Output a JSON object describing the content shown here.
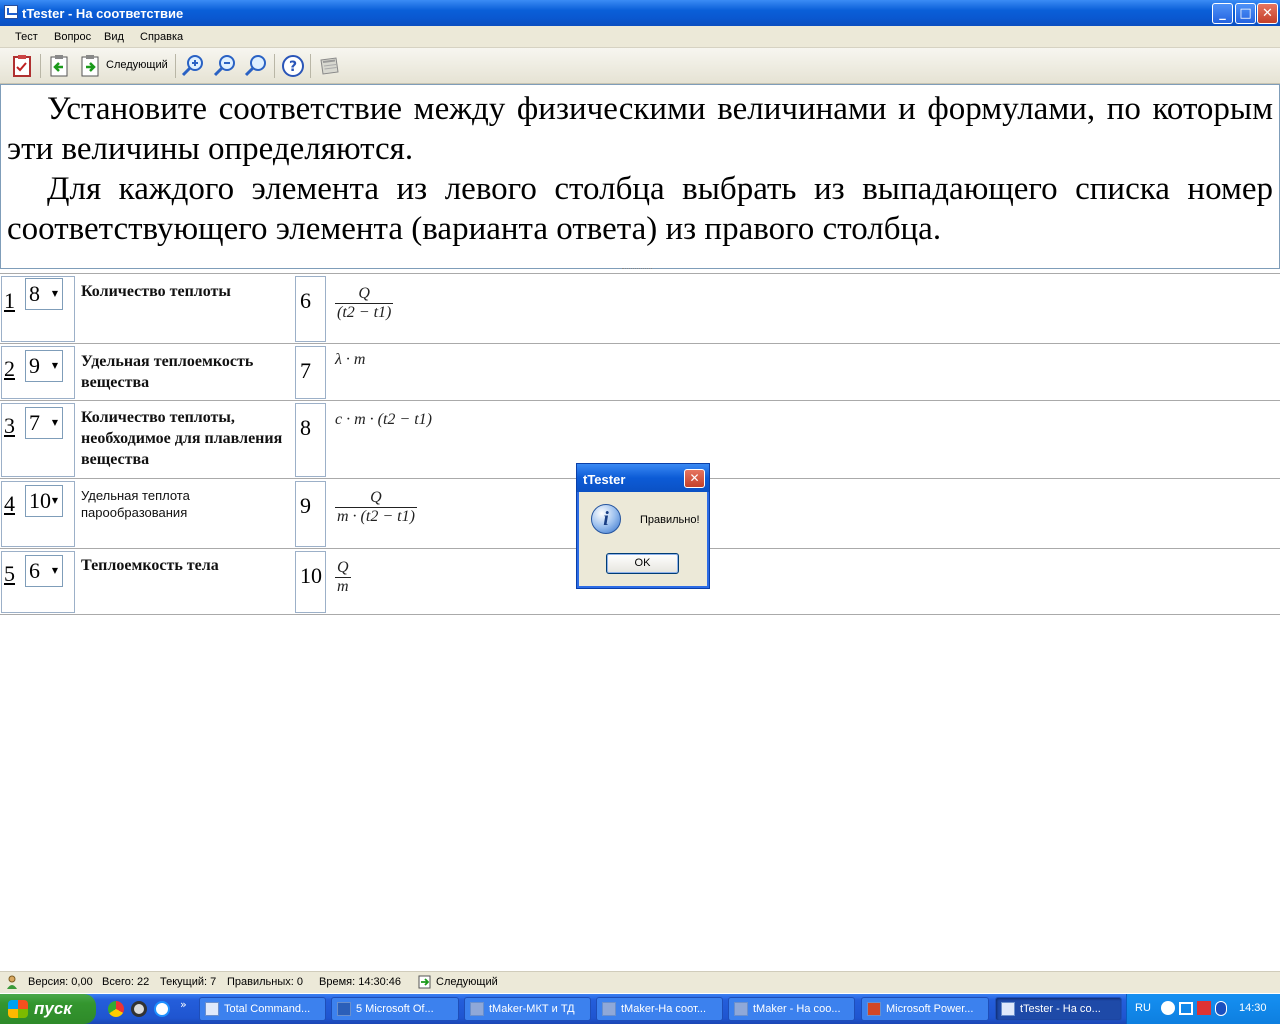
{
  "window": {
    "title": "tTester - На соответствие"
  },
  "menu": [
    "Тест",
    "Вопрос",
    "Вид",
    "Справка"
  ],
  "toolbar": {
    "next_label": "Следующий"
  },
  "question": {
    "para1": "Установите соответствие между физическими величинами и формулами, по которым эти величины определяются.",
    "para2": "Для каждого элемента из левого столбца выбрать из выпадающего списка номер соответствующего элемента (варианта ответа) из правого столбца."
  },
  "rows": [
    {
      "num": "1",
      "selected": "8",
      "label": "Количество теплоты",
      "rnum": "6"
    },
    {
      "num": "2",
      "selected": "9",
      "label": "Удельная теплоемкость вещества",
      "rnum": "7"
    },
    {
      "num": "3",
      "selected": "7",
      "label": "Количество теплоты, необходимое для плавления вещества",
      "rnum": "8"
    },
    {
      "num": "4",
      "selected": "10",
      "label": "Удельная теплота парообразования",
      "rnum": "9"
    },
    {
      "num": "5",
      "selected": "6",
      "label": "Теплоемкость тела",
      "rnum": "10"
    }
  ],
  "formulas": {
    "f6": {
      "num": "Q",
      "den": "(t2 − t1)"
    },
    "f7": "λ · m",
    "f8": "c · m · (t2 − t1)",
    "f9": {
      "num": "Q",
      "den": "m · (t2 − t1)"
    },
    "f10": {
      "num": "Q",
      "den": "m"
    }
  },
  "dialog": {
    "title": "tTester",
    "message": "Правильно!",
    "ok": "OK"
  },
  "status": {
    "version": "Версия: 0,00",
    "total": "Всего: 22",
    "current": "Текущий: 7",
    "correct": "Правильных: 0",
    "time": "Время: 14:30:46",
    "next": "Следующий"
  },
  "taskbar": {
    "start": "пуск",
    "tasks": [
      "Total Command...",
      "5 Microsoft Of...",
      "tMaker-МКТ и ТД",
      "tMaker-На соот...",
      "tMaker - На соо...",
      "Microsoft Power...",
      "tTester - На со..."
    ],
    "lang": "RU",
    "clock": "14:30"
  }
}
